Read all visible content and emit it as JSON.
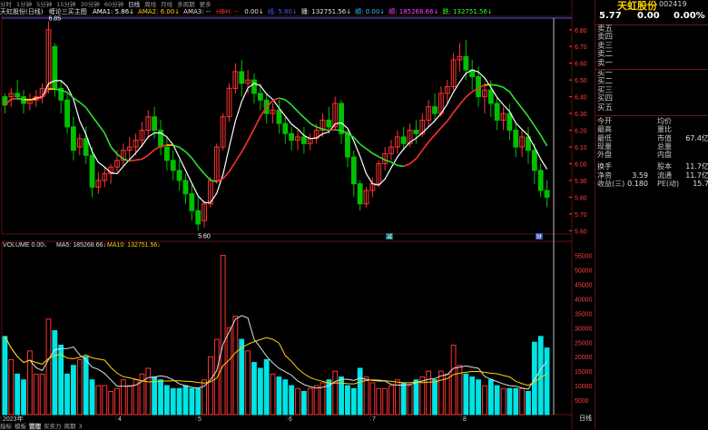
{
  "top_tabs": [
    "分时",
    "1分钟",
    "5分钟",
    "15分钟",
    "30分钟",
    "60分钟",
    "日线",
    "周线",
    "月线",
    "多周期",
    "更多"
  ],
  "top_active": "日线",
  "info_line": {
    "title": "天虹股份(日线)",
    "formula": "缠论三买主图",
    "items": [
      {
        "label": "AMA1: 5.86↓",
        "color": "#ffffff"
      },
      {
        "label": "AMA2: 6.00↓",
        "color": "#ffd400"
      },
      {
        "label": "AMA3: -- ",
        "color": "#e0e0e0"
      },
      {
        "label": "HBH: -- ",
        "color": "#ff3030"
      },
      {
        "label": "0.00↓",
        "color": "#e0e0e0"
      },
      {
        "label": "线: 5.80↓",
        "color": "#4060ff"
      },
      {
        "label": "播: 132751.56↓",
        "color": "#e0e0e0"
      },
      {
        "label": "顺: 0.00↓",
        "color": "#30c0ff"
      },
      {
        "label": "顺: 185268.66↓",
        "color": "#ff40ff"
      },
      {
        "label": "跌: 132751.56↓",
        "color": "#30ff30"
      }
    ]
  },
  "chart": {
    "high_label": "6.85",
    "low_label": "5.60",
    "price_ticks": [
      "6.80",
      "6.70",
      "6.60",
      "6.50",
      "6.40",
      "6.30",
      "6.20",
      "6.10",
      "6.00",
      "5.90",
      "5.80",
      "5.70",
      "5.60"
    ],
    "vol_ticks": [
      "55000",
      "50000",
      "45000",
      "40000",
      "35000",
      "30000",
      "25000",
      "20000",
      "15000",
      "10000",
      "5000"
    ],
    "x_labels": [
      "2023年",
      "4",
      "5",
      "6",
      "7",
      "8"
    ],
    "x_unit": "日线",
    "volume_header": {
      "title": "VOLUME 0.00↓",
      "ma5": "MA5: 185268.66↓",
      "ma10": "MA10: 132751.56↓"
    },
    "marker_mid": "减",
    "marker_right": "财"
  },
  "chart_data": {
    "type": "candlestick",
    "ylim": [
      5.58,
      6.88
    ],
    "candles": [
      [
        6.4,
        6.42,
        6.35,
        6.3
      ],
      [
        6.4,
        6.45,
        6.42,
        6.34
      ],
      [
        6.42,
        6.5,
        6.4,
        6.38
      ],
      [
        6.4,
        6.44,
        6.36,
        6.3
      ],
      [
        6.36,
        6.42,
        6.38,
        6.32
      ],
      [
        6.38,
        6.44,
        6.4,
        6.34
      ],
      [
        6.4,
        6.48,
        6.45,
        6.36
      ],
      [
        6.45,
        6.85,
        6.8,
        6.42
      ],
      [
        6.7,
        6.72,
        6.45,
        6.4
      ],
      [
        6.45,
        6.5,
        6.38,
        6.3
      ],
      [
        6.38,
        6.42,
        6.22,
        6.18
      ],
      [
        6.22,
        6.28,
        6.08,
        6.02
      ],
      [
        6.1,
        6.18,
        6.15,
        6.05
      ],
      [
        6.15,
        6.22,
        6.05,
        6.0
      ],
      [
        6.05,
        6.1,
        5.86,
        5.8
      ],
      [
        5.86,
        5.95,
        5.9,
        5.82
      ],
      [
        5.9,
        5.98,
        5.94,
        5.86
      ],
      [
        5.94,
        6.0,
        5.98,
        5.88
      ],
      [
        5.98,
        6.08,
        6.02,
        5.95
      ],
      [
        6.02,
        6.12,
        6.08,
        5.98
      ],
      [
        6.08,
        6.16,
        6.1,
        6.02
      ],
      [
        6.1,
        6.18,
        6.14,
        6.05
      ],
      [
        6.14,
        6.25,
        6.2,
        6.1
      ],
      [
        6.2,
        6.32,
        6.28,
        6.15
      ],
      [
        6.28,
        6.34,
        6.2,
        6.15
      ],
      [
        6.2,
        6.26,
        6.1,
        6.05
      ],
      [
        6.1,
        6.16,
        6.02,
        5.96
      ],
      [
        6.02,
        6.08,
        5.96,
        5.9
      ],
      [
        5.96,
        6.02,
        5.9,
        5.84
      ],
      [
        5.9,
        5.94,
        5.82,
        5.76
      ],
      [
        5.82,
        5.88,
        5.72,
        5.66
      ],
      [
        5.72,
        5.8,
        5.64,
        5.6
      ],
      [
        5.66,
        5.78,
        5.76,
        5.62
      ],
      [
        5.76,
        5.92,
        5.9,
        5.74
      ],
      [
        5.9,
        6.12,
        6.1,
        5.88
      ],
      [
        6.1,
        6.3,
        6.28,
        6.08
      ],
      [
        6.28,
        6.48,
        6.45,
        6.25
      ],
      [
        6.45,
        6.6,
        6.55,
        6.42
      ],
      [
        6.55,
        6.62,
        6.48,
        6.4
      ],
      [
        6.48,
        6.56,
        6.5,
        6.42
      ],
      [
        6.5,
        6.54,
        6.42,
        6.36
      ],
      [
        6.42,
        6.48,
        6.38,
        6.32
      ],
      [
        6.38,
        6.42,
        6.3,
        6.24
      ],
      [
        6.3,
        6.36,
        6.32,
        6.24
      ],
      [
        6.32,
        6.38,
        6.24,
        6.18
      ],
      [
        6.24,
        6.28,
        6.18,
        6.12
      ],
      [
        6.18,
        6.22,
        6.14,
        6.08
      ],
      [
        6.14,
        6.2,
        6.16,
        6.08
      ],
      [
        6.16,
        6.22,
        6.12,
        6.06
      ],
      [
        6.12,
        6.18,
        6.15,
        6.08
      ],
      [
        6.15,
        6.24,
        6.2,
        6.12
      ],
      [
        6.2,
        6.3,
        6.26,
        6.16
      ],
      [
        6.26,
        6.34,
        6.22,
        6.18
      ],
      [
        6.22,
        6.4,
        6.36,
        6.2
      ],
      [
        6.36,
        6.38,
        6.18,
        6.12
      ],
      [
        6.18,
        6.2,
        6.04,
        5.98
      ],
      [
        6.04,
        6.08,
        5.88,
        5.8
      ],
      [
        5.88,
        5.9,
        5.76,
        5.72
      ],
      [
        5.76,
        5.86,
        5.84,
        5.74
      ],
      [
        5.84,
        5.92,
        5.88,
        5.8
      ],
      [
        5.88,
        6.02,
        6.0,
        5.86
      ],
      [
        6.0,
        6.1,
        6.06,
        5.96
      ],
      [
        6.06,
        6.14,
        6.1,
        6.02
      ],
      [
        6.1,
        6.2,
        6.16,
        6.06
      ],
      [
        6.16,
        6.22,
        6.12,
        6.08
      ],
      [
        6.12,
        6.24,
        6.2,
        6.1
      ],
      [
        6.2,
        6.26,
        6.18,
        6.12
      ],
      [
        6.18,
        6.3,
        6.26,
        6.16
      ],
      [
        6.26,
        6.38,
        6.34,
        6.22
      ],
      [
        6.34,
        6.42,
        6.3,
        6.26
      ],
      [
        6.3,
        6.46,
        6.42,
        6.28
      ],
      [
        6.42,
        6.5,
        6.46,
        6.36
      ],
      [
        6.46,
        6.66,
        6.62,
        6.44
      ],
      [
        6.62,
        6.72,
        6.64,
        6.55
      ],
      [
        6.64,
        6.74,
        6.56,
        6.5
      ],
      [
        6.56,
        6.62,
        6.52,
        6.44
      ],
      [
        6.52,
        6.58,
        6.4,
        6.34
      ],
      [
        6.4,
        6.48,
        6.44,
        6.3
      ],
      [
        6.44,
        6.5,
        6.36,
        6.28
      ],
      [
        6.36,
        6.4,
        6.26,
        6.2
      ],
      [
        6.26,
        6.34,
        6.3,
        6.2
      ],
      [
        6.3,
        6.36,
        6.2,
        6.14
      ],
      [
        6.2,
        6.24,
        6.1,
        6.04
      ],
      [
        6.1,
        6.2,
        6.16,
        6.04
      ],
      [
        6.16,
        6.22,
        6.08,
        6.0
      ],
      [
        6.08,
        6.12,
        5.96,
        5.88
      ],
      [
        5.96,
        6.0,
        5.84,
        5.8
      ],
      [
        5.84,
        5.9,
        5.8,
        5.74
      ]
    ],
    "volume": [
      27,
      19,
      14,
      12,
      22,
      14,
      14,
      33,
      29,
      24,
      14,
      17,
      19,
      20,
      12,
      10,
      10,
      8,
      9,
      12,
      10,
      12,
      14,
      16,
      13,
      12,
      10,
      9,
      9,
      10,
      9,
      9,
      12,
      20,
      26,
      55,
      30,
      34,
      26,
      22,
      18,
      16,
      19,
      14,
      13,
      12,
      10,
      9,
      8,
      9,
      10,
      11,
      12,
      15,
      13,
      10,
      9,
      16,
      13,
      11,
      9,
      9,
      10,
      12,
      11,
      10,
      12,
      13,
      15,
      12,
      15,
      14,
      24,
      17,
      14,
      13,
      12,
      10,
      12,
      10,
      9,
      9,
      9,
      9,
      8,
      25,
      27,
      23
    ]
  },
  "right_panel": {
    "name": "天虹股份",
    "code": "002419",
    "price": "5.77",
    "change": "0.00",
    "change_pct": "0.00%",
    "order_book": [
      "卖五",
      "卖四",
      "卖三",
      "卖二",
      "卖一",
      "买一",
      "买二",
      "买三",
      "买四",
      "买五"
    ],
    "stats": [
      [
        "今开",
        "",
        "均价",
        ""
      ],
      [
        "最高",
        "",
        "量比",
        ""
      ],
      [
        "最低",
        "",
        "市值",
        "67.4亿"
      ],
      [
        "现量",
        "",
        "总量",
        ""
      ],
      [
        "外盘",
        "",
        "内盘",
        ""
      ],
      [
        "换手",
        "",
        "股本",
        "11.7亿"
      ],
      [
        "净资",
        "3.59",
        "流通",
        "11.7亿"
      ],
      [
        "收益(三)",
        "0.180",
        "PE(动)",
        "15.7"
      ]
    ]
  },
  "bottom_tabs": [
    "指标",
    "模板",
    "管理",
    "买卖力",
    "周期",
    "3"
  ],
  "bottom_active": "管理",
  "colors": {
    "up": "#ff3232",
    "down": "#00e4e4",
    "down_candle": "#00c000",
    "up_candle": "#ff3232",
    "grid": "#5a1010"
  }
}
